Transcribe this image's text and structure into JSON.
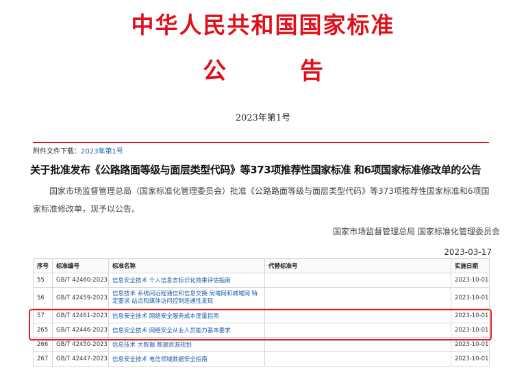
{
  "header": {
    "title": "中华人民共和国国家标准",
    "subtitle": "公 告",
    "issue": "2023年第1号"
  },
  "attachment": {
    "label": "附件文件下载：",
    "link": "2023年第1号"
  },
  "notice": {
    "title": "关于批准发布《公路路面等级与面层类型代码》等373项推荐性国家标准 和6项国家标准修改单的公告",
    "body": "国家市场监督管理总局（国家标准化管理委员会）批准《公路路面等级与面层类型代码》等373项推荐性国家标准和6项国家标准修改单，现予以公告。",
    "signer": "国家市场监督管理总局 国家标准化管理委员会",
    "date": "2023-03-17"
  },
  "table": {
    "headers": [
      "序号",
      "标准编号",
      "标准名称",
      "代替标准号",
      "实施日期"
    ],
    "rows": [
      {
        "no": "55",
        "code": "GB/T 42460-2023",
        "name": "信息安全技术 个人信息去标识化效果评估指南",
        "replace": "",
        "date": "2023-10-01"
      },
      {
        "no": "56",
        "code": "GB/T 42459-2023",
        "name": "信息技术 系统间远程通信和信息交换 局域网和城域网 特定要求 站点和媒体访问控制连通性发现",
        "replace": "",
        "date": "2023-10-01"
      },
      {
        "no": "57",
        "code": "GB/T 42461-2023",
        "name": "信息安全技术 网络安全服务成本度量指南",
        "replace": "",
        "date": "2023-10-01"
      },
      {
        "no": "265",
        "code": "GB/T 42446-2023",
        "name": "信息安全技术 网络安全从业人员能力基本要求",
        "replace": "",
        "date": "2023-10-01"
      },
      {
        "no": "266",
        "code": "GB/T 42450-2023",
        "name": "信息技术 大数据 数据资源规划",
        "replace": "",
        "date": "2023-10-01"
      },
      {
        "no": "267",
        "code": "GB/T 42447-2023",
        "name": "信息安全技术 电信领域数据安全指南",
        "replace": "",
        "date": "2023-10-01"
      }
    ]
  }
}
